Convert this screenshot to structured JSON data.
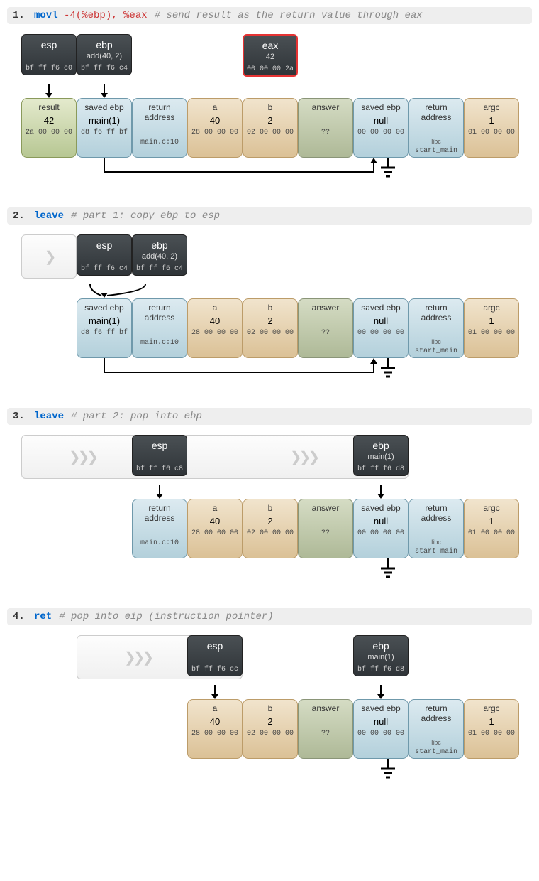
{
  "steps": [
    {
      "num": "1.",
      "instr": "movl",
      "operands": "-4(%ebp), %eax",
      "comment": "# send result as the return value through eax",
      "registers": [
        {
          "name": "esp",
          "sub": "",
          "hex": "bf ff f6 c0",
          "offset": 0
        },
        {
          "name": "ebp",
          "sub": "add(40, 2)",
          "hex": "bf ff f6 c4",
          "offset": 1
        }
      ],
      "extra_reg": {
        "name": "eax",
        "sub": "42",
        "hex": "00 00 00 2a",
        "highlight": true,
        "offset": 4
      },
      "ghost_before_regs": false,
      "stack_start": 0,
      "stack": [
        {
          "name": "result",
          "val": "42",
          "hex": "2a 00 00 00",
          "cls": "c-green"
        },
        {
          "name": "saved ebp",
          "val": "main(1)",
          "hex": "d8 f6 ff bf",
          "cls": "c-blue"
        },
        {
          "name": "return",
          "sub": "address",
          "val": "",
          "hex": "main.c:10",
          "cls": "c-blue"
        },
        {
          "name": "a",
          "val": "40",
          "hex": "28 00 00 00",
          "cls": "c-tan"
        },
        {
          "name": "b",
          "val": "2",
          "hex": "02 00 00 00",
          "cls": "c-tan"
        },
        {
          "name": "answer",
          "val": "",
          "hex": "??",
          "cls": "c-olive"
        },
        {
          "name": "saved ebp",
          "val": "null",
          "hex": "00 00 00 00",
          "cls": "c-blue"
        },
        {
          "name": "return",
          "sub": "address",
          "val": "",
          "hex2": "libc",
          "hex": "start_main",
          "cls": "c-blue"
        },
        {
          "name": "argc",
          "val": "1",
          "hex": "01 00 00 00",
          "cls": "c-tan"
        }
      ],
      "connector_from": 1,
      "connector_to": 6,
      "ground_at": 6
    },
    {
      "num": "2.",
      "instr": "leave",
      "operands": "",
      "comment": "# part 1: copy ebp to esp",
      "registers": [
        {
          "name": "esp",
          "sub": "",
          "hex": "bf ff f6 c4",
          "offset": 1
        },
        {
          "name": "ebp",
          "sub": "add(40, 2)",
          "hex": "bf ff f6 c4",
          "offset": 2
        }
      ],
      "ghost_before_regs": true,
      "stack_start": 1,
      "stack": [
        {
          "name": "saved ebp",
          "val": "main(1)",
          "hex": "d8 f6 ff bf",
          "cls": "c-blue"
        },
        {
          "name": "return",
          "sub": "address",
          "val": "",
          "hex": "main.c:10",
          "cls": "c-blue"
        },
        {
          "name": "a",
          "val": "40",
          "hex": "28 00 00 00",
          "cls": "c-tan"
        },
        {
          "name": "b",
          "val": "2",
          "hex": "02 00 00 00",
          "cls": "c-tan"
        },
        {
          "name": "answer",
          "val": "",
          "hex": "??",
          "cls": "c-olive"
        },
        {
          "name": "saved ebp",
          "val": "null",
          "hex": "00 00 00 00",
          "cls": "c-blue"
        },
        {
          "name": "return",
          "sub": "address",
          "val": "",
          "hex2": "libc",
          "hex": "start_main",
          "cls": "c-blue"
        },
        {
          "name": "argc",
          "val": "1",
          "hex": "01 00 00 00",
          "cls": "c-tan"
        }
      ],
      "merge_arrows_at": 1,
      "connector_from": 1,
      "connector_to": 6,
      "ground_at": 6
    },
    {
      "num": "3.",
      "instr": "leave",
      "operands": "",
      "comment": "# part 2: pop into ebp",
      "registers": [
        {
          "name": "esp",
          "sub": "",
          "hex": "bf ff f6 c8",
          "offset": 2
        },
        {
          "name": "ebp",
          "sub": "main(1)",
          "hex": "bf ff f6 d8",
          "offset": 6
        }
      ],
      "ghost_strip": {
        "from": 0,
        "to": 6,
        "chevrons": [
          1,
          5
        ]
      },
      "stack_start": 2,
      "stack": [
        {
          "name": "return",
          "sub": "address",
          "val": "",
          "hex": "main.c:10",
          "cls": "c-blue"
        },
        {
          "name": "a",
          "val": "40",
          "hex": "28 00 00 00",
          "cls": "c-tan"
        },
        {
          "name": "b",
          "val": "2",
          "hex": "02 00 00 00",
          "cls": "c-tan"
        },
        {
          "name": "answer",
          "val": "",
          "hex": "??",
          "cls": "c-olive"
        },
        {
          "name": "saved ebp",
          "val": "null",
          "hex": "00 00 00 00",
          "cls": "c-blue"
        },
        {
          "name": "return",
          "sub": "address",
          "val": "",
          "hex2": "libc",
          "hex": "start_main",
          "cls": "c-blue"
        },
        {
          "name": "argc",
          "val": "1",
          "hex": "01 00 00 00",
          "cls": "c-tan"
        }
      ],
      "ground_at": 6
    },
    {
      "num": "4.",
      "instr": "ret",
      "operands": "",
      "comment": "# pop into eip (instruction pointer)",
      "registers": [
        {
          "name": "esp",
          "sub": "",
          "hex": "bf ff f6 cc",
          "offset": 3
        },
        {
          "name": "ebp",
          "sub": "main(1)",
          "hex": "bf ff f6 d8",
          "offset": 6
        }
      ],
      "ghost_strip": {
        "from": 1,
        "to": 3,
        "chevrons": [
          2
        ]
      },
      "stack_start": 3,
      "stack": [
        {
          "name": "a",
          "val": "40",
          "hex": "28 00 00 00",
          "cls": "c-tan"
        },
        {
          "name": "b",
          "val": "2",
          "hex": "02 00 00 00",
          "cls": "c-tan"
        },
        {
          "name": "answer",
          "val": "",
          "hex": "??",
          "cls": "c-olive"
        },
        {
          "name": "saved ebp",
          "val": "null",
          "hex": "00 00 00 00",
          "cls": "c-blue"
        },
        {
          "name": "return",
          "sub": "address",
          "val": "",
          "hex2": "libc",
          "hex": "start_main",
          "cls": "c-blue"
        },
        {
          "name": "argc",
          "val": "1",
          "hex": "01 00 00 00",
          "cls": "c-tan"
        }
      ],
      "ground_at": 6
    }
  ]
}
